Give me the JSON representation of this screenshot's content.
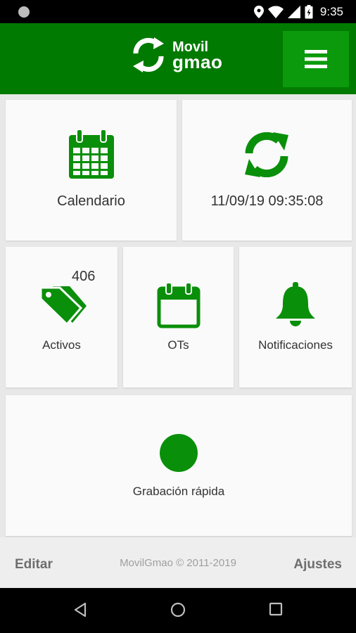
{
  "status_bar": {
    "time": "9:35",
    "icons": [
      "location-icon",
      "wifi-icon",
      "signal-icon",
      "battery-icon"
    ]
  },
  "header": {
    "logo_line1": "Movil",
    "logo_line2": "gmao",
    "menu_icon": "hamburger-icon"
  },
  "tiles": {
    "calendario": {
      "label": "Calendario",
      "icon": "calendar-icon"
    },
    "sync": {
      "label": "11/09/19 09:35:08",
      "icon": "sync-icon"
    },
    "activos": {
      "label": "Activos",
      "badge": "406",
      "icon": "tags-icon"
    },
    "ots": {
      "label": "OTs",
      "icon": "calendar-blank-icon"
    },
    "notificaciones": {
      "label": "Notificaciones",
      "icon": "bell-icon"
    },
    "grabacion": {
      "label": "Grabación rápida",
      "icon": "record-circle-icon"
    }
  },
  "footer": {
    "edit_label": "Editar",
    "copyright": "MovilGmao © 2011-2019",
    "settings_label": "Ajustes"
  },
  "nav_bar": {
    "buttons": [
      "back-icon",
      "home-icon",
      "recents-icon"
    ]
  },
  "colors": {
    "brand_green": "#007a00",
    "menu_green": "#0b9a0b",
    "icon_green": "#0a8f0a"
  }
}
